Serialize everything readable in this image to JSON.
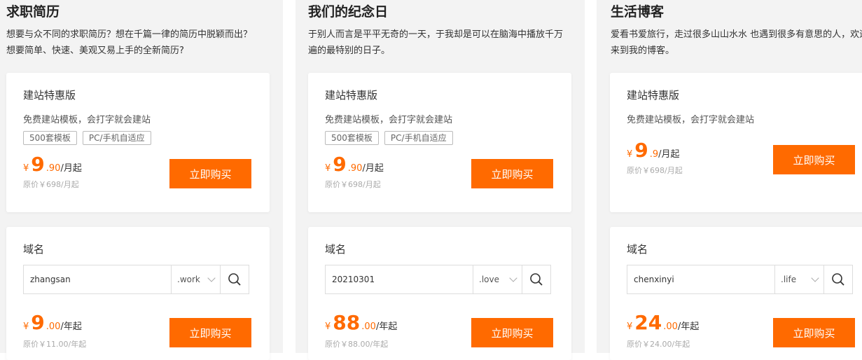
{
  "columns": [
    {
      "title": "求职简历",
      "desc": "想要与众不同的求职简历？想在千篇一律的简历中脱颖而出？想要简单、快速、美观又易上手的全新简历?",
      "site": {
        "title": "建站特惠版",
        "subtitle": "免费建站模板，会打字就会建站",
        "tags": [
          "500套模板",
          "PC/手机自适应"
        ],
        "price_currency": "¥",
        "price_int": "9",
        "price_dec": ".90",
        "price_unit": "/月起",
        "original": "原价￥698/月起",
        "buy_label": "立即购买"
      },
      "domain": {
        "title": "域名",
        "value": "zhangsan",
        "suffix": ".work",
        "price_currency": "¥",
        "price_int": "9",
        "price_dec": ".00",
        "price_unit": "/年起",
        "original": "原价￥11.00/年起",
        "buy_label": "立即购买"
      }
    },
    {
      "title": "我们的纪念日",
      "desc": "于别人而言是平平无奇的一天，于我却是可以在脑海中播放千万遍的最特别的日子。",
      "site": {
        "title": "建站特惠版",
        "subtitle": "免费建站模板，会打字就会建站",
        "tags": [
          "500套模板",
          "PC/手机自适应"
        ],
        "price_currency": "¥",
        "price_int": "9",
        "price_dec": ".90",
        "price_unit": "/月起",
        "original": "原价￥698/月起",
        "buy_label": "立即购买"
      },
      "domain": {
        "title": "域名",
        "value": "20210301",
        "suffix": ".love",
        "price_currency": "¥",
        "price_int": "88",
        "price_dec": ".00",
        "price_unit": "/年起",
        "original": "原价￥88.00/年起",
        "buy_label": "立即购买"
      }
    },
    {
      "title": "生活博客",
      "desc": "爱看书爱旅行，走过很多山山水水 也遇到很多有意思的人，欢迎来到我的博客。",
      "site": {
        "title": "建站特惠版",
        "subtitle": "免费建站模板，会打字就会建站",
        "price_currency": "¥",
        "price_int": "9",
        "price_dec": ".9",
        "price_unit": "/月起",
        "original": "原价￥698/月起",
        "buy_label": "立即购买"
      },
      "domain": {
        "title": "域名",
        "value": "chenxinyi",
        "suffix": ".life",
        "price_currency": "¥",
        "price_int": "24",
        "price_dec": ".00",
        "price_unit": "/年起",
        "original": "原价￥24.00/年起",
        "buy_label": "立即购买"
      }
    }
  ],
  "colors": {
    "accent": "#ff6a00",
    "background": "#f3f3f3"
  },
  "icons": {
    "search": "search-icon",
    "dropdown": "chevron-down-icon"
  }
}
